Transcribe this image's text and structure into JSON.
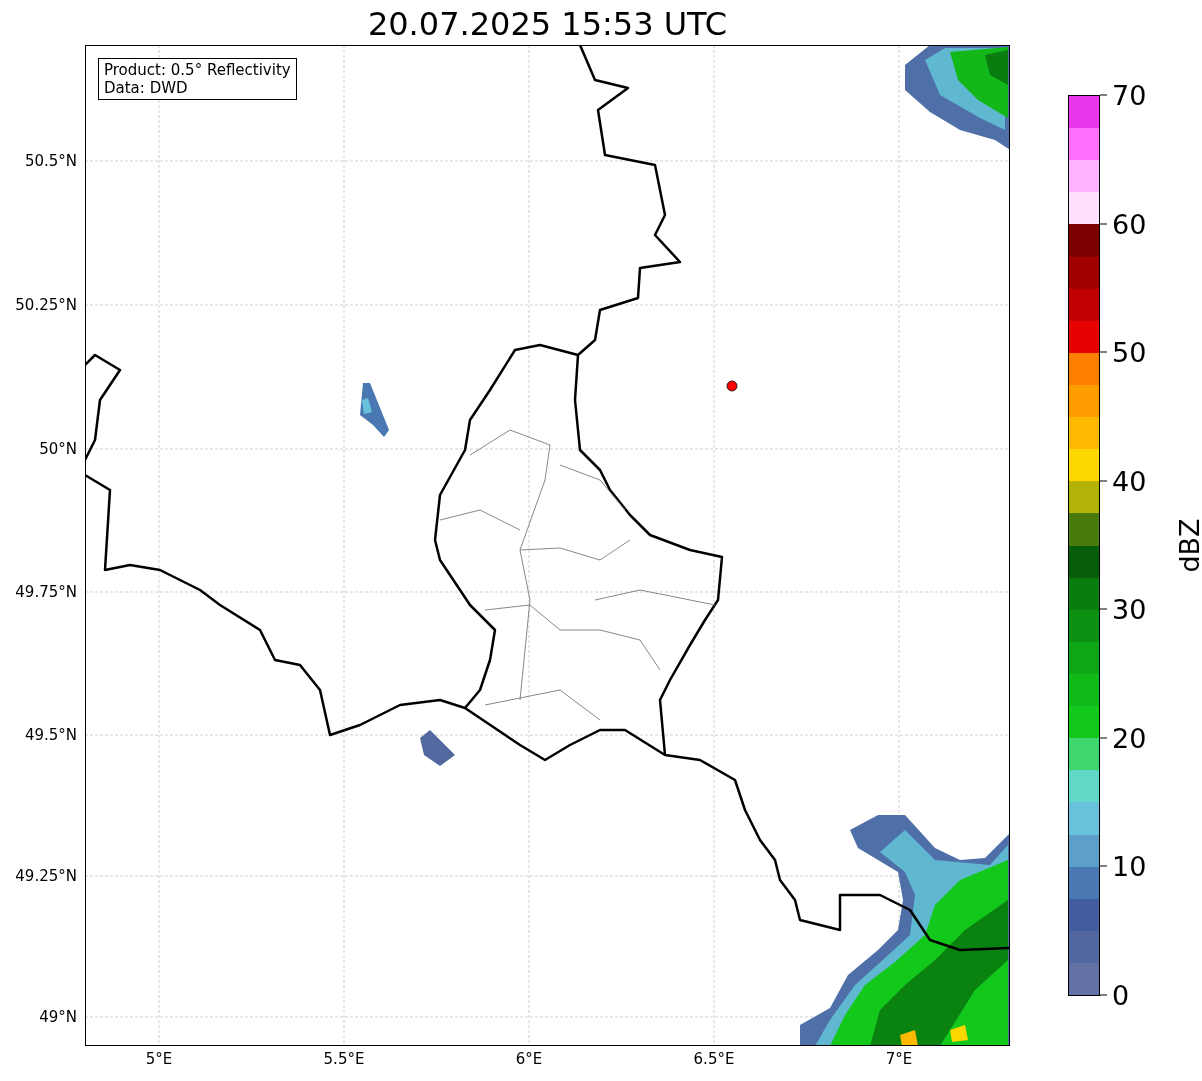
{
  "title": "20.07.2025 15:53 UTC",
  "info_box": [
    "Product: 0.5° Reflectivity",
    "Data: DWD"
  ],
  "map": {
    "x_tick_labels": [
      "5°E",
      "5.5°E",
      "6°E",
      "6.5°E",
      "7°E"
    ],
    "y_tick_labels": [
      "50.5°N",
      "50.25°N",
      "50°N",
      "49.75°N",
      "49.5°N",
      "49.25°N",
      "49°N"
    ]
  },
  "colorbar": {
    "label": "dBZ",
    "ticks": [
      "70",
      "60",
      "50",
      "40",
      "30",
      "20",
      "10",
      "0"
    ],
    "segments": [
      {
        "color": "#ea37ee"
      },
      {
        "color": "#ff70ff"
      },
      {
        "color": "#ffb2ff"
      },
      {
        "color": "#ffe1ff"
      },
      {
        "color": "#7c0000"
      },
      {
        "color": "#a00000"
      },
      {
        "color": "#c00000"
      },
      {
        "color": "#e60000"
      },
      {
        "color": "#ff7f00"
      },
      {
        "color": "#ff9c00"
      },
      {
        "color": "#ffb900"
      },
      {
        "color": "#ffd700"
      },
      {
        "color": "#b2b306"
      },
      {
        "color": "#4a7a0c"
      },
      {
        "color": "#065e0d"
      },
      {
        "color": "#0a7d10"
      },
      {
        "color": "#0c9012"
      },
      {
        "color": "#0ea715"
      },
      {
        "color": "#10ba19"
      },
      {
        "color": "#12c81a"
      },
      {
        "color": "#3ed66f"
      },
      {
        "color": "#62d8c6"
      },
      {
        "color": "#68c2dc"
      },
      {
        "color": "#5c9fc8"
      },
      {
        "color": "#4a78b2"
      },
      {
        "color": "#415da0"
      },
      {
        "color": "#52669f"
      },
      {
        "color": "#6272a6"
      }
    ]
  }
}
